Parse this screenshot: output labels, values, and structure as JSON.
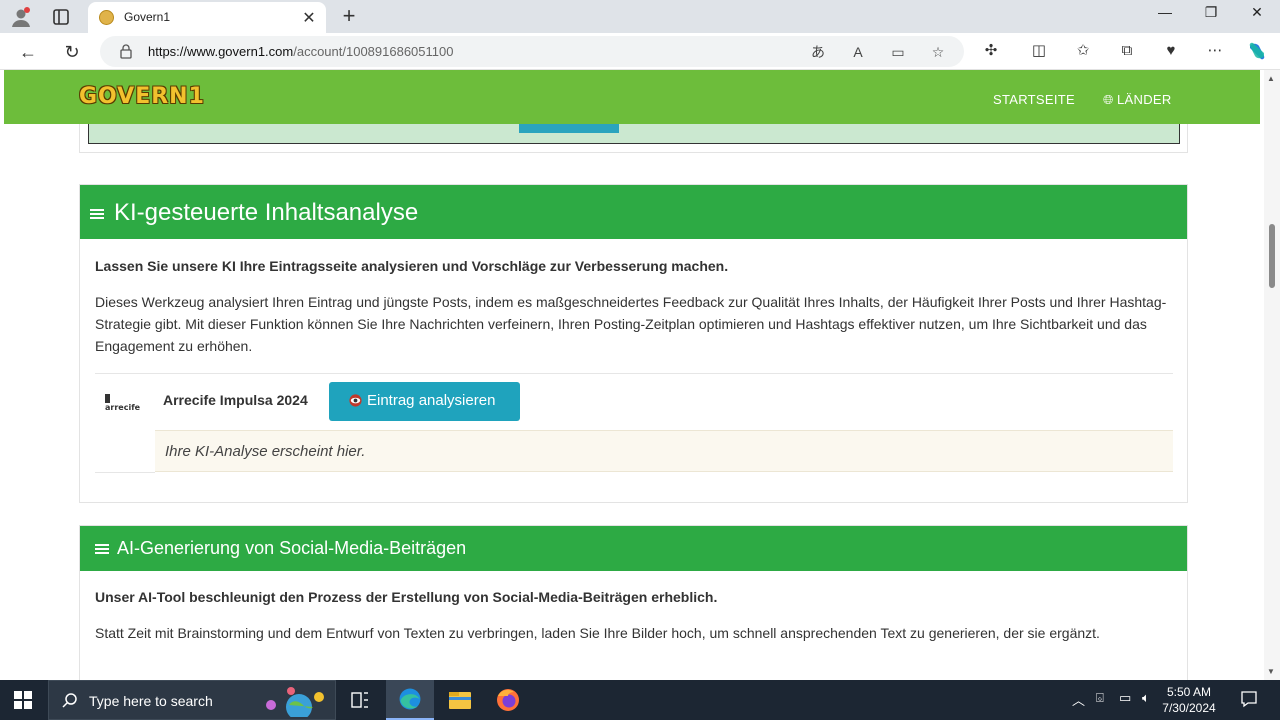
{
  "browser": {
    "tab_title": "Govern1",
    "tab_close": "✕",
    "new_tab": "+",
    "url_domain": "https://www.govern1.com",
    "url_path": "/account/100891686051100",
    "window": {
      "minimize": "—",
      "maximize": "❐",
      "close": "✕"
    }
  },
  "site": {
    "logo_text": "GOVERN1",
    "nav": {
      "home": "STARTSEITE",
      "countries": "LÄNDER"
    }
  },
  "card1": {
    "title": "KI-gesteuerte Inhaltsanalyse",
    "lead": "Lassen Sie unsere KI Ihre Eintragsseite analysieren und Vorschläge zur Verbesserung machen.",
    "description": "Dieses Werkzeug analysiert Ihren Eintrag und jüngste Posts, indem es maßgeschneidertes Feedback zur Qualität Ihres Inhalts, der Häufigkeit Ihrer Posts und Ihrer Hashtag-Strategie gibt. Mit dieser Funktion können Sie Ihre Nachrichten verfeinern, Ihren Posting-Zeitplan optimieren und Hashtags effektiver nutzen, um Ihre Sichtbarkeit und das Engagement zu erhöhen.",
    "entry_logo": "arrecife",
    "entry_name": "Arrecife Impulsa 2024",
    "analyze_button": "Eintrag analysieren",
    "result_placeholder": "Ihre KI-Analyse erscheint hier."
  },
  "card2": {
    "title": "AI-Generierung von Social-Media-Beiträgen",
    "lead": "Unser AI-Tool beschleunigt den Prozess der Erstellung von Social-Media-Beiträgen erheblich.",
    "description": "Statt Zeit mit Brainstorming und dem Entwurf von Texten zu verbringen, laden Sie Ihre Bilder hoch, um schnell ansprechenden Text zu generieren, der sie ergänzt."
  },
  "taskbar": {
    "search_placeholder": "Type here to search",
    "time": "5:50 AM",
    "date": "7/30/2024"
  },
  "colors": {
    "site_header": "#6dbd3b",
    "card_header": "#2daa44",
    "button": "#1fa3bd"
  }
}
